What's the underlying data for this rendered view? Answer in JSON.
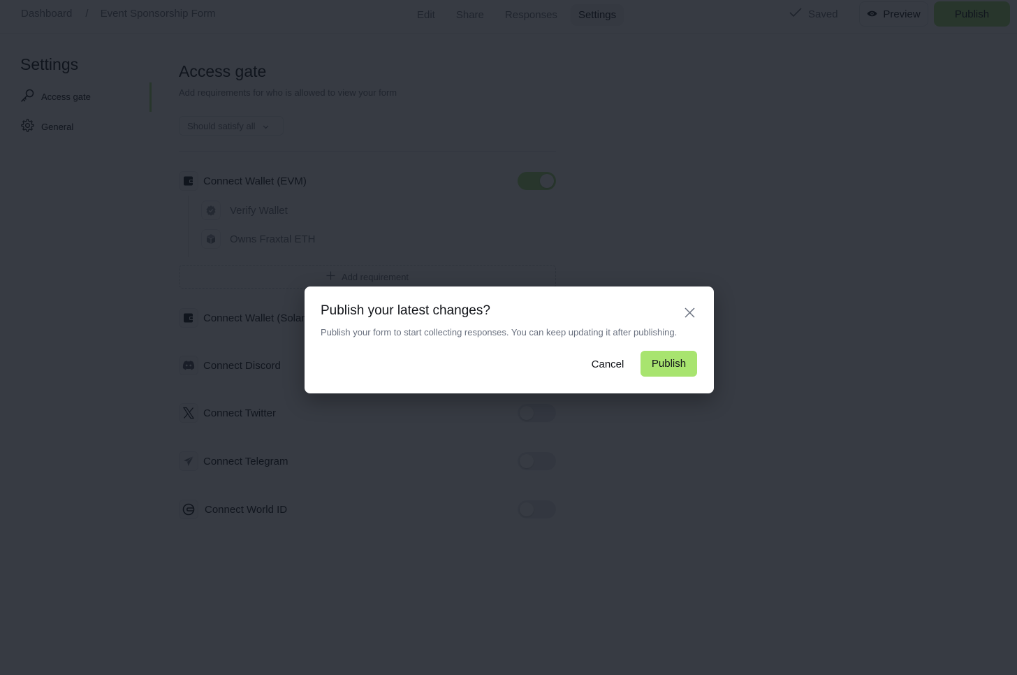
{
  "header": {
    "breadcrumb": [
      "Dashboard",
      "Event Sponsorship Form"
    ],
    "breadcrumb_separator": "/",
    "tabs": [
      {
        "label": "Edit",
        "active": false
      },
      {
        "label": "Share",
        "active": false
      },
      {
        "label": "Responses",
        "active": false
      },
      {
        "label": "Settings",
        "active": true
      }
    ],
    "status": "Saved",
    "preview_label": "Preview",
    "publish_label": "Publish"
  },
  "sidebar": {
    "title": "Settings",
    "items": [
      {
        "label": "Access gate",
        "icon": "key-icon",
        "active": true
      },
      {
        "label": "General",
        "icon": "gear-icon",
        "active": false
      }
    ]
  },
  "main": {
    "title": "Access gate",
    "subtitle": "Add requirements for who is allowed to view your form",
    "satisfy_select": "Should satisfy all",
    "requirements": [
      {
        "label": "Connect Wallet (EVM)",
        "icon": "wallet-icon",
        "enabled": true,
        "sub_requirements": [
          {
            "label": "Verify Wallet",
            "icon": "verified-badge-icon"
          },
          {
            "label": "Owns Fraxtal ETH",
            "icon": "cube-icon"
          }
        ],
        "add_requirement_label": "Add requirement"
      },
      {
        "label": "Connect Wallet (Solana)",
        "icon": "wallet-icon",
        "enabled": false
      },
      {
        "label": "Connect Discord",
        "icon": "discord-icon",
        "enabled": false
      },
      {
        "label": "Connect Twitter",
        "icon": "x-twitter-icon",
        "enabled": false
      },
      {
        "label": "Connect Telegram",
        "icon": "telegram-icon",
        "enabled": false
      },
      {
        "label": "Connect World ID",
        "icon": "worldcoin-icon",
        "enabled": false
      }
    ]
  },
  "modal": {
    "title": "Publish your latest changes?",
    "description": "Publish your form to start collecting responses. You can keep updating it after publishing.",
    "cancel_label": "Cancel",
    "publish_label": "Publish"
  },
  "colors": {
    "accent": "#9fdc72",
    "modal_publish": "#a8e46f"
  }
}
